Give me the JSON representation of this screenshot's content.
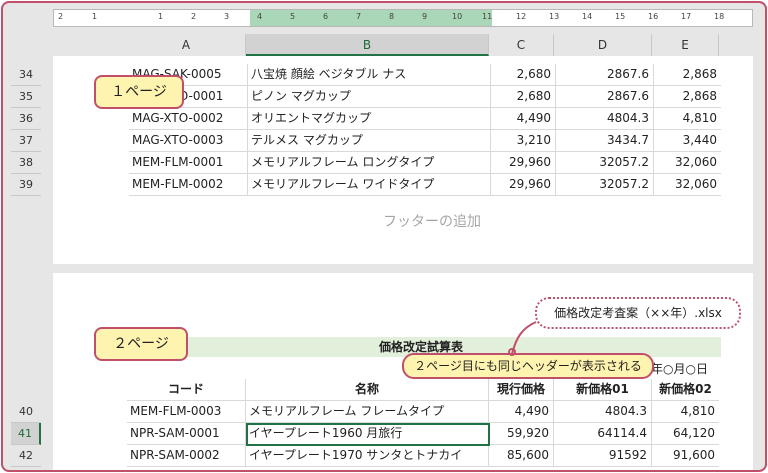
{
  "ruler": {
    "ticks": [
      "2",
      "1",
      "",
      "1",
      "2",
      "3",
      "4",
      "5",
      "6",
      "7",
      "8",
      "9",
      "10",
      "11",
      "12",
      "13",
      "14",
      "15",
      "16",
      "17",
      "18"
    ]
  },
  "columns": [
    "A",
    "B",
    "C",
    "D",
    "E"
  ],
  "page1": {
    "rows": [
      {
        "num": "34",
        "a": "MAG-SAK-0005",
        "b": "八宝焼 顔絵 ベジタブル ナス",
        "c": "2,680",
        "d": "2867.6",
        "e": "2,868"
      },
      {
        "num": "35",
        "a": "MAG-XTO-0001",
        "b": "ピノン マグカップ",
        "c": "2,680",
        "d": "2867.6",
        "e": "2,868"
      },
      {
        "num": "36",
        "a": "MAG-XTO-0002",
        "b": "オリエントマグカップ",
        "c": "4,490",
        "d": "4804.3",
        "e": "4,810"
      },
      {
        "num": "37",
        "a": "MAG-XTO-0003",
        "b": "テルメス マグカップ",
        "c": "3,210",
        "d": "3434.7",
        "e": "3,440"
      },
      {
        "num": "38",
        "a": "MEM-FLM-0001",
        "b": "メモリアルフレーム ロングタイプ",
        "c": "29,960",
        "d": "32057.2",
        "e": "32,060"
      },
      {
        "num": "39",
        "a": "MEM-FLM-0002",
        "b": "メモリアルフレーム ワイドタイプ",
        "c": "29,960",
        "d": "32057.2",
        "e": "32,060"
      }
    ],
    "footer_placeholder": "フッターの追加"
  },
  "page2": {
    "header_file": "価格改定考査案（××年）.xlsx",
    "sheet_title": "価格改定試算表",
    "date": "年○月○日",
    "table_headers": {
      "a": "コード",
      "b": "名称",
      "c": "現行価格",
      "d": "新価格01",
      "e": "新価格02"
    },
    "rows": [
      {
        "num": "40",
        "a": "MEM-FLM-0003",
        "b": "メモリアルフレーム フレームタイプ",
        "c": "4,490",
        "d": "4804.3",
        "e": "4,810"
      },
      {
        "num": "41",
        "a": "NPR-SAM-0001",
        "b": "イヤープレート1960 月旅行",
        "c": "59,920",
        "d": "64114.4",
        "e": "64,120"
      },
      {
        "num": "42",
        "a": "NPR-SAM-0002",
        "b": "イヤープレート1970 サンタとトナカイ",
        "c": "85,600",
        "d": "91592",
        "e": "91,600"
      }
    ]
  },
  "callouts": {
    "page1_label": "１ページ",
    "page2_label": "２ページ",
    "header_note": "２ページ目にも同じヘッダーが表示される"
  }
}
